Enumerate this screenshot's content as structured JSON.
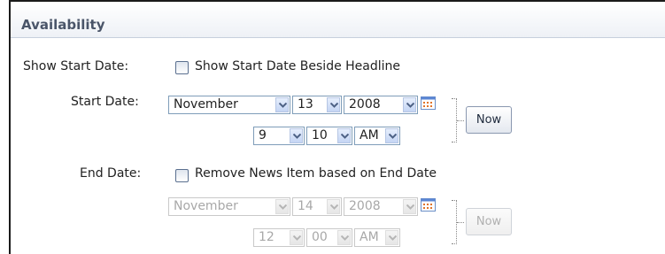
{
  "section": {
    "title": "Availability"
  },
  "show_start_date": {
    "label": "Show Start Date:",
    "checkbox_label": "Show Start Date Beside Headline",
    "checked": false
  },
  "start_date": {
    "label": "Start Date:",
    "month": "November",
    "day": "13",
    "year": "2008",
    "hour": "9",
    "minute": "10",
    "ampm": "AM",
    "now_label": "Now",
    "enabled": true
  },
  "end_date": {
    "label": "End Date:",
    "checkbox_label": "Remove News Item based on End Date",
    "checked": false,
    "month": "November",
    "day": "14",
    "year": "2008",
    "hour": "12",
    "minute": "00",
    "ampm": "AM",
    "now_label": "Now",
    "enabled": false
  },
  "icons": {
    "dropdown": "chevron-down-icon",
    "calendar": "calendar-icon"
  },
  "colors": {
    "header_title": "#4a5569",
    "input_border": "#7f9db9",
    "disabled_text": "#a8a8a8"
  }
}
